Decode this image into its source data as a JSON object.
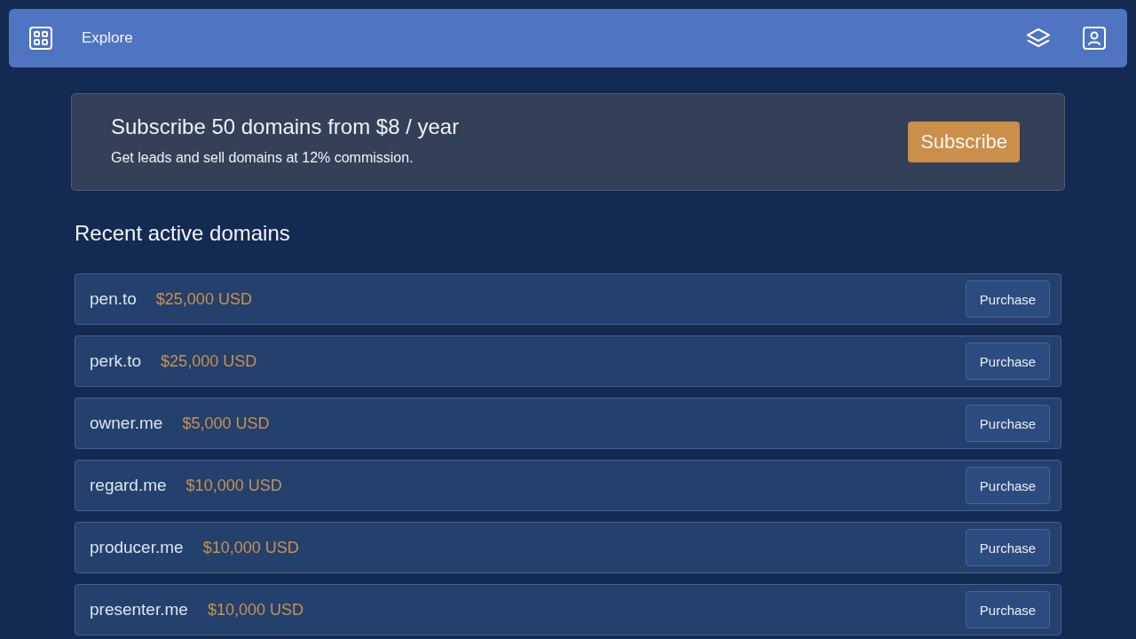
{
  "header": {
    "title": "Explore"
  },
  "promo": {
    "title": "Subscribe 50 domains from $8 / year",
    "subtitle": "Get leads and sell domains at 12% commission.",
    "button": "Subscribe"
  },
  "section": {
    "title": "Recent active domains"
  },
  "domains": [
    {
      "name": "pen.to",
      "price": "$25,000 USD",
      "button": "Purchase"
    },
    {
      "name": "perk.to",
      "price": "$25,000 USD",
      "button": "Purchase"
    },
    {
      "name": "owner.me",
      "price": "$5,000 USD",
      "button": "Purchase"
    },
    {
      "name": "regard.me",
      "price": "$10,000 USD",
      "button": "Purchase"
    },
    {
      "name": "producer.me",
      "price": "$10,000 USD",
      "button": "Purchase"
    },
    {
      "name": "presenter.me",
      "price": "$10,000 USD",
      "button": "Purchase"
    }
  ]
}
